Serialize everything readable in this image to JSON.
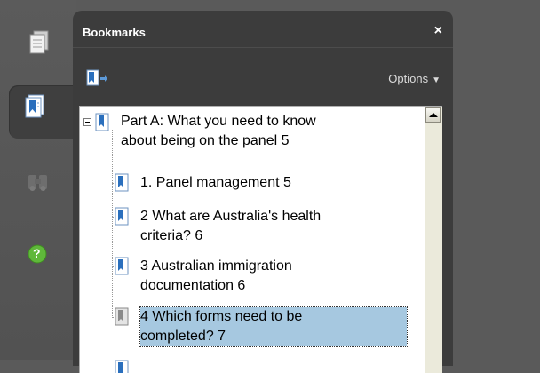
{
  "panel": {
    "title": "Bookmarks",
    "close_label": "×",
    "options_label": "Options",
    "options_caret": "▼"
  },
  "rail": {
    "icons": [
      "pages-icon",
      "bookmarks-icon",
      "attachments-icon",
      "help-icon"
    ],
    "help_label": "?"
  },
  "bookmarks": [
    {
      "line1": "Part A: What you need to know",
      "line2": "about being on the panel 5"
    },
    {
      "line1": "1. Panel management 5"
    },
    {
      "line1": "2 What are Australia's health",
      "line2": "criteria? 6"
    },
    {
      "line1": "3 Australian immigration",
      "line2": "documentation 6"
    },
    {
      "line1": "4 Which forms need to be",
      "line2": "completed? 7"
    }
  ],
  "colors": {
    "panel_bg": "#3c3c3c",
    "rail_bg": "#555555",
    "selection": "#a6c8e0",
    "bookmark_icon_blue": "#2a6fbd",
    "help_green": "#5fb83a"
  }
}
